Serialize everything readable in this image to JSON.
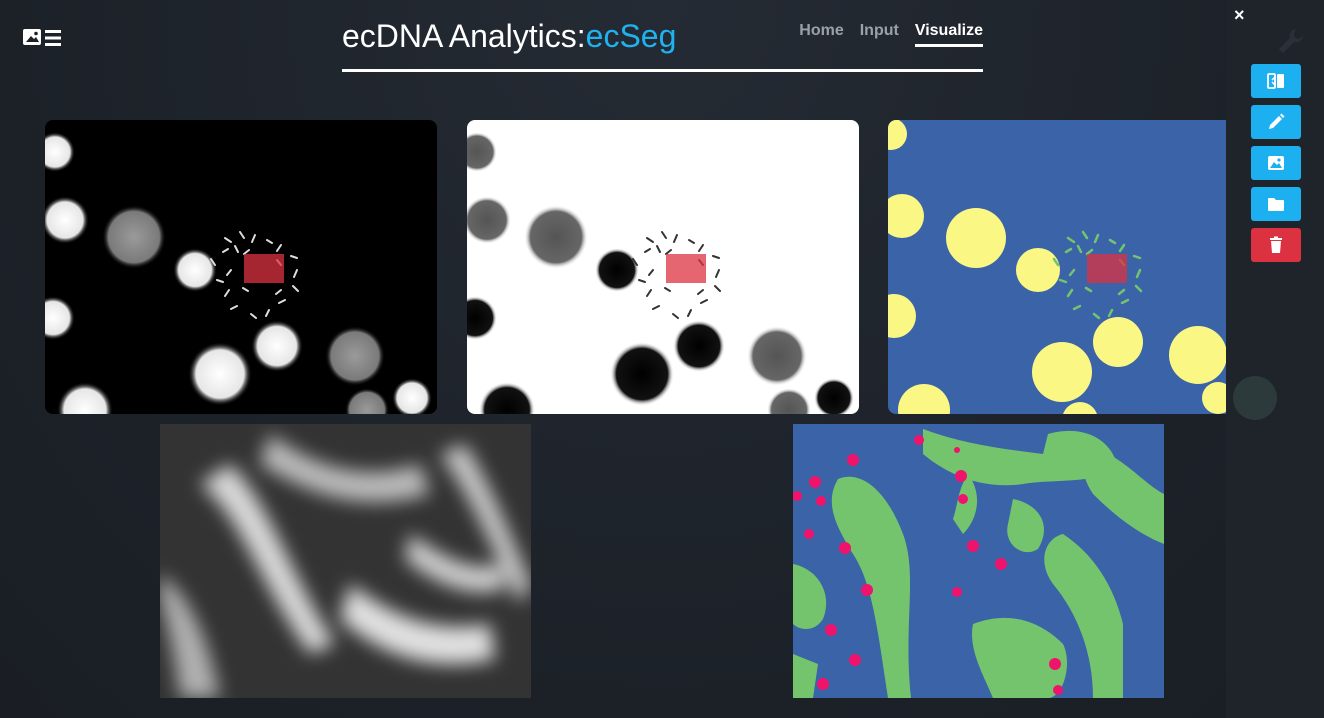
{
  "app": {
    "title_main": "ecDNA Analytics:",
    "title_accent": "ecSeg"
  },
  "nav": {
    "items": [
      "Home",
      "Input",
      "Visualize"
    ],
    "active": "Visualize"
  },
  "sidebar": {
    "close_glyph": "×",
    "tools": [
      {
        "name": "compare-icon"
      },
      {
        "name": "pencil-icon"
      },
      {
        "name": "image-icon"
      },
      {
        "name": "folder-icon"
      },
      {
        "name": "trash-icon"
      }
    ]
  },
  "colors": {
    "accent": "#1fb2f0",
    "tool_button": "#1cb0f0",
    "delete_button": "#dc3141",
    "segmentation_background": "#3a63a8",
    "segmentation_nuclei": "#fbf784",
    "segmentation_chromosome": "#74c46e",
    "segmentation_ecdna": "#f0136c",
    "selection_box": "#dc3141"
  }
}
